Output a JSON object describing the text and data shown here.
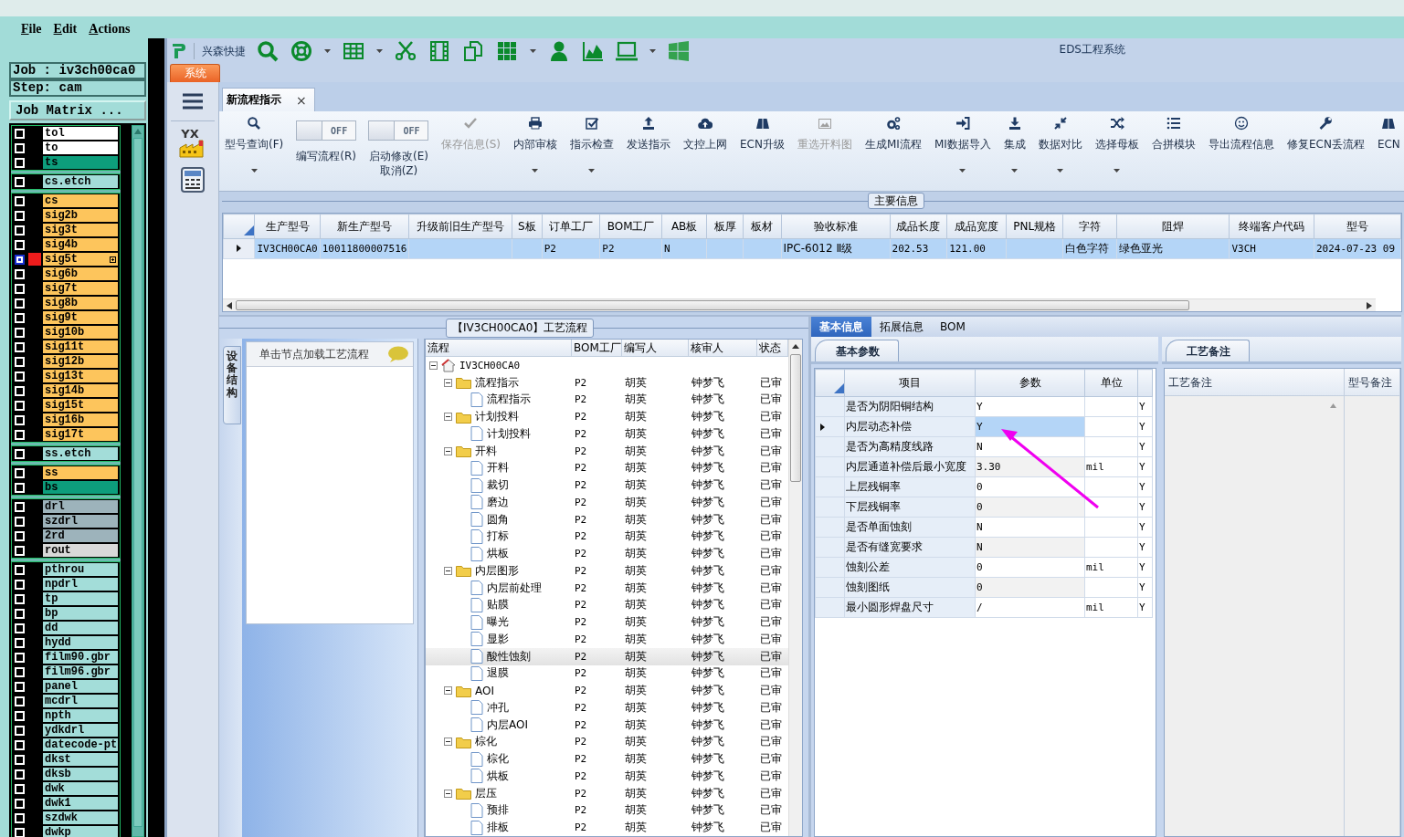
{
  "menubar": [
    "File",
    "Edit",
    "Actions"
  ],
  "job_panel": {
    "job": "Job : iv3ch00ca0",
    "step": "Step: cam",
    "matrix_button": "Job Matrix ...",
    "layer_groups": [
      [
        {
          "name": "tol",
          "color": "#ffffff",
          "selected": false
        },
        {
          "name": "to",
          "color": "#ffffff",
          "selected": false
        },
        {
          "name": "ts",
          "color": "#0d9e7c",
          "selected": false
        }
      ],
      [
        {
          "name": "cs.etch",
          "color": "#a3ddd9",
          "selected": false
        }
      ],
      [
        {
          "name": "cs",
          "color": "#fdc55c",
          "selected": false
        },
        {
          "name": "sig2b",
          "color": "#fdc55c",
          "selected": false
        },
        {
          "name": "sig3t",
          "color": "#fdc55c",
          "selected": false
        },
        {
          "name": "sig4b",
          "color": "#fdc55c",
          "selected": false
        },
        {
          "name": "sig5t",
          "color": "#fdc55c",
          "selected": true
        },
        {
          "name": "sig6b",
          "color": "#fdc55c",
          "selected": false
        },
        {
          "name": "sig7t",
          "color": "#fdc55c",
          "selected": false
        },
        {
          "name": "sig8b",
          "color": "#fdc55c",
          "selected": false
        },
        {
          "name": "sig9t",
          "color": "#fdc55c",
          "selected": false
        },
        {
          "name": "sig10b",
          "color": "#fdc55c",
          "selected": false
        },
        {
          "name": "sig11t",
          "color": "#fdc55c",
          "selected": false
        },
        {
          "name": "sig12b",
          "color": "#fdc55c",
          "selected": false
        },
        {
          "name": "sig13t",
          "color": "#fdc55c",
          "selected": false
        },
        {
          "name": "sig14b",
          "color": "#fdc55c",
          "selected": false
        },
        {
          "name": "sig15t",
          "color": "#fdc55c",
          "selected": false
        },
        {
          "name": "sig16b",
          "color": "#fdc55c",
          "selected": false
        },
        {
          "name": "sig17t",
          "color": "#fdc55c",
          "selected": false
        }
      ],
      [
        {
          "name": "ss.etch",
          "color": "#a3ddd9",
          "selected": false
        }
      ],
      [
        {
          "name": "ss",
          "color": "#fdc55c",
          "selected": false
        },
        {
          "name": "bs",
          "color": "#0d9e7c",
          "selected": false
        }
      ],
      [
        {
          "name": "drl",
          "color": "#9db3bb",
          "selected": false
        },
        {
          "name": "szdrl",
          "color": "#9db3bb",
          "selected": false
        },
        {
          "name": "2rd",
          "color": "#9db3bb",
          "selected": false
        },
        {
          "name": "rout",
          "color": "#d9d9d9",
          "selected": false
        }
      ],
      [
        {
          "name": "pthrou",
          "color": "#a3ddd9",
          "selected": false
        },
        {
          "name": "npdrl",
          "color": "#a3ddd9",
          "selected": false
        },
        {
          "name": "tp",
          "color": "#a3ddd9",
          "selected": false
        },
        {
          "name": "bp",
          "color": "#a3ddd9",
          "selected": false
        },
        {
          "name": "dd",
          "color": "#a3ddd9",
          "selected": false
        },
        {
          "name": "hydd",
          "color": "#a3ddd9",
          "selected": false
        },
        {
          "name": "film90.gbr",
          "color": "#a3ddd9",
          "selected": false
        },
        {
          "name": "film96.gbr",
          "color": "#a3ddd9",
          "selected": false
        },
        {
          "name": "panel",
          "color": "#a3ddd9",
          "selected": false
        },
        {
          "name": "mcdrl",
          "color": "#a3ddd9",
          "selected": false
        },
        {
          "name": "npth",
          "color": "#a3ddd9",
          "selected": false
        },
        {
          "name": "ydkdrl",
          "color": "#a3ddd9",
          "selected": false
        },
        {
          "name": "datecode-pt",
          "color": "#a3ddd9",
          "selected": false
        },
        {
          "name": "dkst",
          "color": "#a3ddd9",
          "selected": false
        },
        {
          "name": "dksb",
          "color": "#a3ddd9",
          "selected": false
        },
        {
          "name": "dwk",
          "color": "#a3ddd9",
          "selected": false
        },
        {
          "name": "dwk1",
          "color": "#a3ddd9",
          "selected": false
        },
        {
          "name": "szdwk",
          "color": "#a3ddd9",
          "selected": false
        },
        {
          "name": "dwkp",
          "color": "#a3ddd9",
          "selected": false
        }
      ]
    ]
  },
  "window": {
    "brand": "兴森快捷",
    "title": "EDS工程系统",
    "system_tab": "系统",
    "side_logo": "YX"
  },
  "doc_tabs": [
    {
      "label": "新流程指示",
      "close": "×",
      "selected": true
    }
  ],
  "ribbon": [
    {
      "kind": "button",
      "label": "型号查询(F)",
      "disabled": false,
      "dropdown": true
    },
    {
      "kind": "toggle",
      "toggle": "OFF",
      "on": false,
      "label": "编写流程(R)",
      "disabled": false,
      "dropdown": false
    },
    {
      "kind": "toggle",
      "toggle": "OFF",
      "on": false,
      "label": "启动修改(E)",
      "sublabel": "取消(Z)",
      "disabled": false,
      "dropdown": false
    },
    {
      "kind": "button",
      "label": "保存信息(S)",
      "disabled": true,
      "dropdown": false
    },
    {
      "kind": "button",
      "label": "内部审核",
      "disabled": false,
      "dropdown": true
    },
    {
      "kind": "button",
      "label": "指示检查",
      "disabled": false,
      "dropdown": true
    },
    {
      "kind": "button",
      "label": "发送指示",
      "disabled": false,
      "dropdown": false
    },
    {
      "kind": "button",
      "label": "文控上网",
      "disabled": false,
      "dropdown": false
    },
    {
      "kind": "button",
      "label": "ECN升级",
      "disabled": false,
      "dropdown": false
    },
    {
      "kind": "button",
      "label": "重选开料图",
      "disabled": true,
      "dropdown": false
    },
    {
      "kind": "button",
      "label": "生成MI流程",
      "disabled": false,
      "dropdown": false
    },
    {
      "kind": "button",
      "label": "MI数据导入",
      "disabled": false,
      "dropdown": true
    },
    {
      "kind": "button",
      "label": "集成",
      "disabled": false,
      "dropdown": true
    },
    {
      "kind": "button",
      "label": "数据对比",
      "disabled": false,
      "dropdown": true
    },
    {
      "kind": "button",
      "label": "选择母板",
      "disabled": false,
      "dropdown": true
    },
    {
      "kind": "button",
      "label": "合拼模块",
      "disabled": false,
      "dropdown": false
    },
    {
      "kind": "button",
      "label": "导出流程信息",
      "disabled": false,
      "dropdown": false
    },
    {
      "kind": "button",
      "label": "修复ECN丢流程",
      "disabled": false,
      "dropdown": false
    },
    {
      "kind": "button",
      "label": "ECN",
      "disabled": false,
      "dropdown": false
    }
  ],
  "main_info": {
    "title": "主要信息",
    "columns": [
      "生产型号",
      "新生产型号",
      "升级前旧生产型号",
      "S板",
      "订单工厂",
      "BOM工厂",
      "AB板",
      "板厚",
      "板材",
      "验收标准",
      "成品长度",
      "成品宽度",
      "PNL规格",
      "字符",
      "阻焊",
      "终端客户代码",
      "型号"
    ],
    "rows": [
      {
        "selected": true,
        "cells": [
          "IV3CH00CA0",
          "10011800007516",
          null,
          null,
          "P2",
          "P2",
          "N",
          null,
          null,
          "IPC-6012 Ⅱ级",
          "202.53",
          "121.00",
          null,
          "白色字符",
          "绿色亚光",
          "V3CH",
          "2024-07-23 09"
        ]
      }
    ]
  },
  "flow": {
    "title": "【IV3CH00CA0】工艺流程",
    "side_tab": "设备结构",
    "hint": "单击节点加载工艺流程",
    "columns": [
      "流程",
      "BOM工厂",
      "编写人",
      "核审人",
      "状态"
    ],
    "tree": [
      {
        "label": "IV3CH00CA0",
        "kind": "root",
        "expanded": true,
        "selected": false,
        "children": [
          {
            "label": "流程指示",
            "kind": "folder",
            "expanded": true,
            "selected": false,
            "cells": [
              "P2",
              "胡英",
              "钟梦飞",
              "已审"
            ],
            "children": [
              {
                "label": "流程指示",
                "kind": "file",
                "selected": false,
                "cells": [
                  "P2",
                  "胡英",
                  "钟梦飞",
                  "已审"
                ]
              }
            ]
          },
          {
            "label": "计划投料",
            "kind": "folder",
            "expanded": true,
            "selected": false,
            "cells": [
              "P2",
              "胡英",
              "钟梦飞",
              "已审"
            ],
            "children": [
              {
                "label": "计划投料",
                "kind": "file",
                "selected": false,
                "cells": [
                  "P2",
                  "胡英",
                  "钟梦飞",
                  "已审"
                ]
              }
            ]
          },
          {
            "label": "开料",
            "kind": "folder",
            "expanded": true,
            "selected": false,
            "cells": [
              "P2",
              "胡英",
              "钟梦飞",
              "已审"
            ],
            "children": [
              {
                "label": "开料",
                "kind": "file",
                "selected": false,
                "cells": [
                  "P2",
                  "胡英",
                  "钟梦飞",
                  "已审"
                ]
              },
              {
                "label": "裁切",
                "kind": "file",
                "selected": false,
                "cells": [
                  "P2",
                  "胡英",
                  "钟梦飞",
                  "已审"
                ]
              },
              {
                "label": "磨边",
                "kind": "file",
                "selected": false,
                "cells": [
                  "P2",
                  "胡英",
                  "钟梦飞",
                  "已审"
                ]
              },
              {
                "label": "圆角",
                "kind": "file",
                "selected": false,
                "cells": [
                  "P2",
                  "胡英",
                  "钟梦飞",
                  "已审"
                ]
              },
              {
                "label": "打标",
                "kind": "file",
                "selected": false,
                "cells": [
                  "P2",
                  "胡英",
                  "钟梦飞",
                  "已审"
                ]
              },
              {
                "label": "烘板",
                "kind": "file",
                "selected": false,
                "cells": [
                  "P2",
                  "胡英",
                  "钟梦飞",
                  "已审"
                ]
              }
            ]
          },
          {
            "label": "内层图形",
            "kind": "folder",
            "expanded": true,
            "selected": false,
            "cells": [
              "P2",
              "胡英",
              "钟梦飞",
              "已审"
            ],
            "children": [
              {
                "label": "内层前处理",
                "kind": "file",
                "selected": false,
                "cells": [
                  "P2",
                  "胡英",
                  "钟梦飞",
                  "已审"
                ]
              },
              {
                "label": "贴膜",
                "kind": "file",
                "selected": false,
                "cells": [
                  "P2",
                  "胡英",
                  "钟梦飞",
                  "已审"
                ]
              },
              {
                "label": "曝光",
                "kind": "file",
                "selected": false,
                "cells": [
                  "P2",
                  "胡英",
                  "钟梦飞",
                  "已审"
                ]
              },
              {
                "label": "显影",
                "kind": "file",
                "selected": false,
                "cells": [
                  "P2",
                  "胡英",
                  "钟梦飞",
                  "已审"
                ]
              },
              {
                "label": "酸性蚀刻",
                "kind": "file",
                "selected": true,
                "cells": [
                  "P2",
                  "胡英",
                  "钟梦飞",
                  "已审"
                ]
              },
              {
                "label": "退膜",
                "kind": "file",
                "selected": false,
                "cells": [
                  "P2",
                  "胡英",
                  "钟梦飞",
                  "已审"
                ]
              }
            ]
          },
          {
            "label": "AOI",
            "kind": "folder",
            "expanded": true,
            "selected": false,
            "cells": [
              "P2",
              "胡英",
              "钟梦飞",
              "已审"
            ],
            "children": [
              {
                "label": "冲孔",
                "kind": "file",
                "selected": false,
                "cells": [
                  "P2",
                  "胡英",
                  "钟梦飞",
                  "已审"
                ]
              },
              {
                "label": "内层AOI",
                "kind": "file",
                "selected": false,
                "cells": [
                  "P2",
                  "胡英",
                  "钟梦飞",
                  "已审"
                ]
              }
            ]
          },
          {
            "label": "棕化",
            "kind": "folder",
            "expanded": true,
            "selected": false,
            "cells": [
              "P2",
              "胡英",
              "钟梦飞",
              "已审"
            ],
            "children": [
              {
                "label": "棕化",
                "kind": "file",
                "selected": false,
                "cells": [
                  "P2",
                  "胡英",
                  "钟梦飞",
                  "已审"
                ]
              },
              {
                "label": "烘板",
                "kind": "file",
                "selected": false,
                "cells": [
                  "P2",
                  "胡英",
                  "钟梦飞",
                  "已审"
                ]
              }
            ]
          },
          {
            "label": "层压",
            "kind": "folder",
            "expanded": true,
            "selected": false,
            "cells": [
              "P2",
              "胡英",
              "钟梦飞",
              "已审"
            ],
            "children": [
              {
                "label": "预排",
                "kind": "file",
                "selected": false,
                "cells": [
                  "P2",
                  "胡英",
                  "钟梦飞",
                  "已审"
                ]
              },
              {
                "label": "排板",
                "kind": "file",
                "selected": false,
                "cells": [
                  "P2",
                  "胡英",
                  "钟梦飞",
                  "已审"
                ]
              }
            ]
          }
        ]
      }
    ]
  },
  "details": {
    "tabs": [
      {
        "label": "基本信息",
        "selected": true
      },
      {
        "label": "拓展信息",
        "selected": false
      },
      {
        "label": "BOM",
        "selected": false
      }
    ],
    "params": {
      "tab": "基本参数",
      "columns": [
        "项目",
        "参数",
        "单位"
      ],
      "rows": [
        {
          "item": "是否为阴阳铜结构",
          "value": "Y",
          "column_4": "Y",
          "selected": false
        },
        {
          "item": "内层动态补偿",
          "value": "Y",
          "column_4": "Y",
          "selected": true
        },
        {
          "item": "是否为高精度线路",
          "value": "N",
          "column_4": "Y",
          "selected": false
        },
        {
          "item": "内层通道补偿后最小宽度",
          "value": "3.30",
          "unit": "mil",
          "column_4": "Y",
          "selected": false
        },
        {
          "item": "上层残铜率",
          "value": "0",
          "column_4": "Y",
          "selected": false
        },
        {
          "item": "下层残铜率",
          "value": "0",
          "column_4": "Y",
          "selected": false
        },
        {
          "item": "是否单面蚀刻",
          "value": "N",
          "column_4": "Y",
          "selected": false
        },
        {
          "item": "是否有缝宽要求",
          "value": "N",
          "column_4": "Y",
          "selected": false
        },
        {
          "item": "蚀刻公差",
          "value": "0",
          "unit": "mil",
          "column_4": "Y",
          "selected": false
        },
        {
          "item": "蚀刻图纸",
          "value": "0",
          "column_4": "Y",
          "selected": false
        },
        {
          "item": "最小圆形焊盘尺寸",
          "value": "/",
          "unit": "mil",
          "column_4": "Y",
          "selected": false
        }
      ]
    },
    "notes": {
      "tab": "工艺备注",
      "columns": [
        "工艺备注",
        "型号备注"
      ]
    }
  }
}
